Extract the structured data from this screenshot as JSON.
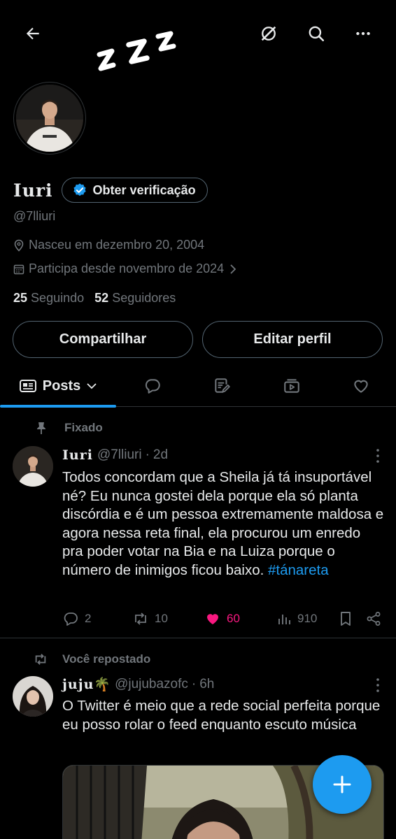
{
  "header": {
    "back_icon": "arrow-left-icon",
    "grok_icon": "grok-icon",
    "search_icon": "search-icon",
    "more_icon": "more-horizontal-icon"
  },
  "profile": {
    "display_name": "Iuri",
    "verify_label": "Obter verificação",
    "handle": "@7lliuri",
    "birthday": "Nasceu em dezembro 20, 2004",
    "joined": "Participa desde novembro de 2024",
    "following_count": "25",
    "following_label": "Seguindo",
    "followers_count": "52",
    "followers_label": "Seguidores",
    "share_label": "Compartilhar",
    "edit_label": "Editar perfil"
  },
  "tabs": {
    "posts_label": "Posts"
  },
  "posts": [
    {
      "context": "Fixado",
      "name": "Iuri",
      "handle": "@7lliuri",
      "separator": "·",
      "time": "2d",
      "text": "Todos concordam que a Sheila já tá insuportável né? Eu nunca gostei dela porque ela só planta discórdia e é um pessoa extremamente maldosa e agora nessa reta final, ela procurou um enredo pra poder votar na Bia e na Luiza porque o número de inimigos ficou baixo.",
      "hashtag": "#tánareta",
      "replies": "2",
      "reposts": "10",
      "likes": "60",
      "views": "910"
    },
    {
      "context": "Você repostado",
      "name": "juju",
      "emoji": "🌴",
      "handle": "@jujubazofc",
      "separator": "·",
      "time": "6h",
      "text": "O Twitter é meio que a rede social perfeita porque eu posso rolar o feed enquanto escuto música"
    }
  ],
  "colors": {
    "accent": "#1d9bf0",
    "like": "#f91880",
    "muted": "#71767b",
    "text": "#e7e9ea",
    "border": "#2f3336"
  }
}
